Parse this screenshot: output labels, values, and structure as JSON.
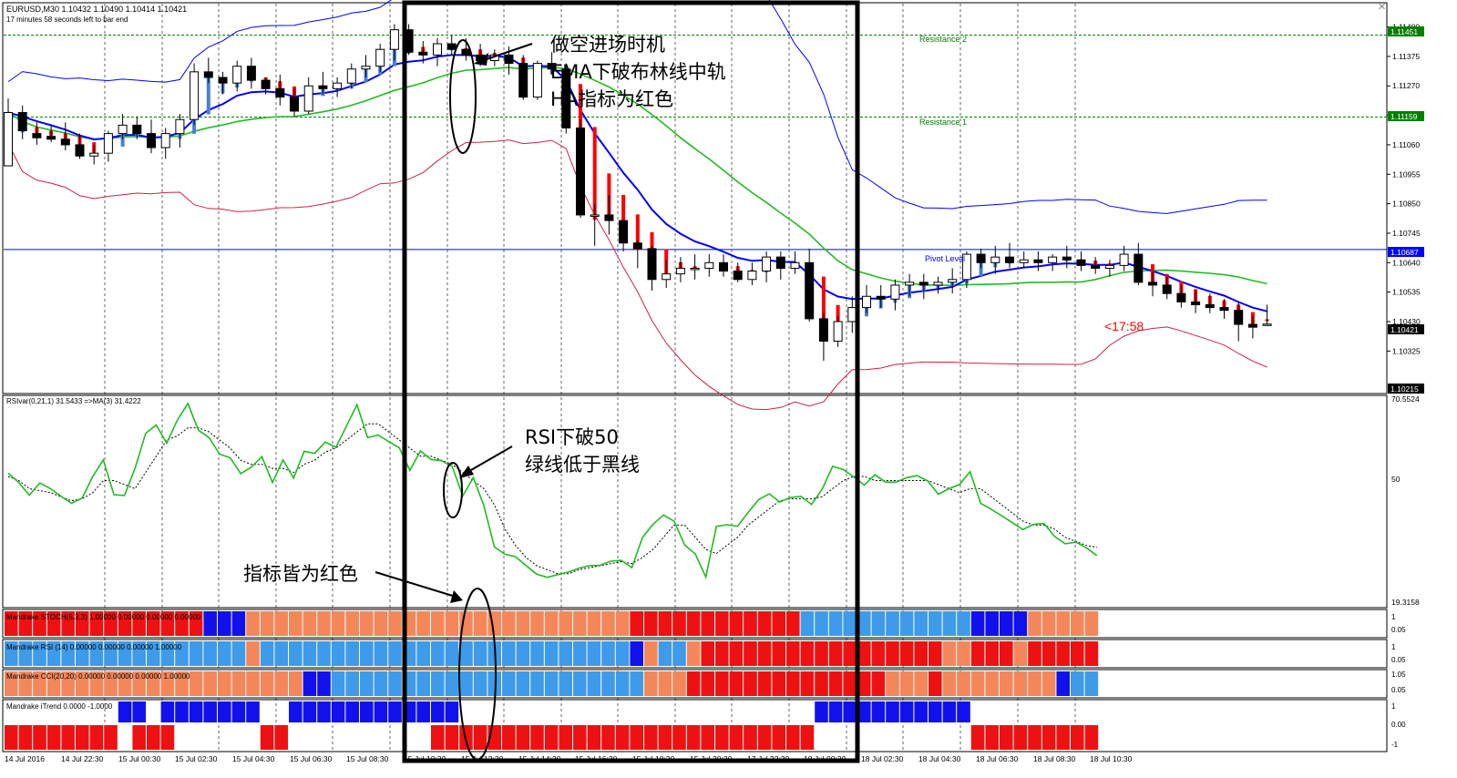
{
  "header": {
    "symbol_line": "EURUSD,M30  1.10432 1.10490 1.10414 1.10421",
    "timer_line": "17 minutes 58 seconds left to bar end"
  },
  "levels": {
    "resistance2": "Resistance 2",
    "resistance1": "Resistance 1",
    "pivot": "Pivot Level",
    "resistance2_price": "1.11451",
    "resistance1_price": "1.11159",
    "pivot_price": "1.10687",
    "current_price": "1.10421",
    "low_price": "1.10215"
  },
  "countdown": "<17:58",
  "annotations": {
    "entry_1": "做空进场时机",
    "entry_2": "EMA下破布林线中轨",
    "entry_3": "HA指标为红色",
    "rsi_1": "RSI下破50",
    "rsi_2": "绿线低于黑线",
    "mandrake": "指标皆为红色"
  },
  "panels": {
    "rsi_label": "RSIvar(0,21,1) 31.5433  =>MA(3) 31.4222",
    "rsi_top": "70.5524",
    "rsi_mid": "50",
    "rsi_bottom": "19.3158",
    "stoch_label": "Mandrake STOCH(5,3,3) 1.00000 0.00000 0.00000 0.00000",
    "rsi_bar_label": "Mandrake RSI (14) 0.00000 0.00000 0.00000 1.00000",
    "cci_label": "Mandrake CCI(20,20) 0.00000 0.00000 0.00000 1.00000",
    "itrend_label": "Mandrake iTrend 0.0000 -1.0000",
    "stoch_scale": [
      "1",
      "0.05"
    ],
    "rsi_bar_scale": [
      "1",
      "0.05"
    ],
    "cci_scale": [
      "1.05",
      "0.05"
    ],
    "itrend_scale": [
      "1",
      "0.00",
      "-1"
    ]
  },
  "time_axis": [
    "14 Jul 2016",
    "14 Jul 22:30",
    "15 Jul 00:30",
    "15 Jul 02:30",
    "15 Jul 04:30",
    "15 Jul 06:30",
    "15 Jul 08:30",
    "15 Jul 10:30",
    "15 Jul 12:30",
    "15 Jul 14:30",
    "15 Jul 16:30",
    "15 Jul 18:30",
    "15 Jul 20:30",
    "17 Jul 22:30",
    "18 Jul 00:30",
    "18 Jul 02:30",
    "18 Jul 04:30",
    "18 Jul 06:30",
    "18 Jul 08:30",
    "18 Jul 10:30"
  ],
  "colors": {
    "bull_candle": "#ffffff",
    "bear_candle": "#000000",
    "ema": "#0000ff",
    "bb_mid": "#22bb22",
    "bb_upper": "#0000ff",
    "bb_lower": "#cc2244",
    "ha_bear": "#ff0000",
    "ha_bull": "#4a7fd8",
    "resistance": "#008000",
    "strong_red": "#ee1111",
    "light_red": "#f4875a",
    "strong_blue": "#1111ee",
    "light_blue": "#3d9be9"
  },
  "chart_data": {
    "type": "candlestick",
    "price_axis": [
      "1.11480",
      "1.11375",
      "1.11270",
      "1.11165",
      "1.11060",
      "1.10955",
      "1.10850",
      "1.10745",
      "1.10640",
      "1.10535",
      "1.10430",
      "1.10325"
    ],
    "ylim": [
      1.1018,
      1.1155
    ],
    "candles": [
      [
        1.10985,
        1.11225,
        1.1113,
        1.11175
      ],
      [
        1.11175,
        1.112,
        1.1108,
        1.1111
      ],
      [
        1.111,
        1.1114,
        1.1106,
        1.11085
      ],
      [
        1.1109,
        1.1113,
        1.1107,
        1.1108
      ],
      [
        1.1108,
        1.1114,
        1.1104,
        1.1106
      ],
      [
        1.1106,
        1.111,
        1.1101,
        1.1102
      ],
      [
        1.1102,
        1.1106,
        1.1099,
        1.1103
      ],
      [
        1.1103,
        1.1111,
        1.11,
        1.111
      ],
      [
        1.111,
        1.1117,
        1.1108,
        1.1113
      ],
      [
        1.1113,
        1.1116,
        1.1108,
        1.111
      ],
      [
        1.111,
        1.1115,
        1.1103,
        1.1105
      ],
      [
        1.1105,
        1.1112,
        1.1101,
        1.111
      ],
      [
        1.111,
        1.1117,
        1.1105,
        1.1115
      ],
      [
        1.1115,
        1.1135,
        1.1113,
        1.1132
      ],
      [
        1.1132,
        1.1137,
        1.1128,
        1.113
      ],
      [
        1.113,
        1.1132,
        1.1124,
        1.1128
      ],
      [
        1.1128,
        1.1136,
        1.1125,
        1.1134
      ],
      [
        1.1134,
        1.1137,
        1.1126,
        1.1129
      ],
      [
        1.1129,
        1.113,
        1.1124,
        1.1126
      ],
      [
        1.1126,
        1.1131,
        1.112,
        1.1123
      ],
      [
        1.1123,
        1.1126,
        1.1116,
        1.1118
      ],
      [
        1.1118,
        1.113,
        1.1117,
        1.1127
      ],
      [
        1.1127,
        1.1132,
        1.1124,
        1.1126
      ],
      [
        1.1126,
        1.113,
        1.1123,
        1.1128
      ],
      [
        1.1128,
        1.1135,
        1.1126,
        1.1133
      ],
      [
        1.1133,
        1.1138,
        1.113,
        1.1134
      ],
      [
        1.1134,
        1.1142,
        1.1132,
        1.114
      ],
      [
        1.114,
        1.1149,
        1.1136,
        1.1147
      ],
      [
        1.1147,
        1.1149,
        1.1138,
        1.1139
      ],
      [
        1.1139,
        1.1143,
        1.1135,
        1.1138
      ],
      [
        1.1138,
        1.1144,
        1.1134,
        1.1142
      ],
      [
        1.1142,
        1.1145,
        1.1138,
        1.114
      ],
      [
        1.114,
        1.1144,
        1.1136,
        1.1138
      ],
      [
        1.1138,
        1.1142,
        1.1134,
        1.1136
      ],
      [
        1.1136,
        1.114,
        1.1134,
        1.1138
      ],
      [
        1.1138,
        1.1141,
        1.1131,
        1.1135
      ],
      [
        1.1135,
        1.1138,
        1.1122,
        1.1123
      ],
      [
        1.1123,
        1.1136,
        1.1122,
        1.1135
      ],
      [
        1.1135,
        1.1139,
        1.1131,
        1.1133
      ],
      [
        1.1133,
        1.1135,
        1.111,
        1.1112
      ],
      [
        1.1112,
        1.1115,
        1.108,
        1.1081
      ],
      [
        1.1081,
        1.1085,
        1.107,
        1.1081
      ],
      [
        1.1081,
        1.1088,
        1.1074,
        1.1079
      ],
      [
        1.1079,
        1.1079,
        1.1068,
        1.1071
      ],
      [
        1.1071,
        1.1072,
        1.1062,
        1.1069
      ],
      [
        1.1069,
        1.107,
        1.1054,
        1.1058
      ],
      [
        1.1058,
        1.1065,
        1.1055,
        1.106
      ],
      [
        1.106,
        1.1066,
        1.1057,
        1.1062
      ],
      [
        1.1062,
        1.1067,
        1.1058,
        1.1062
      ],
      [
        1.1062,
        1.1067,
        1.1059,
        1.1064
      ],
      [
        1.1064,
        1.1067,
        1.1059,
        1.1061
      ],
      [
        1.1061,
        1.1064,
        1.1057,
        1.1058
      ],
      [
        1.1058,
        1.1064,
        1.1056,
        1.1061
      ],
      [
        1.1061,
        1.1068,
        1.1057,
        1.1066
      ],
      [
        1.1066,
        1.1068,
        1.1058,
        1.1062
      ],
      [
        1.1062,
        1.1068,
        1.106,
        1.1064
      ],
      [
        1.1064,
        1.1069,
        1.1043,
        1.1044
      ],
      [
        1.1044,
        1.1046,
        1.1029,
        1.1036
      ],
      [
        1.1036,
        1.1045,
        1.1034,
        1.1043
      ],
      [
        1.1043,
        1.1052,
        1.1039,
        1.1048
      ],
      [
        1.1048,
        1.1056,
        1.1046,
        1.1052
      ],
      [
        1.1052,
        1.1056,
        1.1048,
        1.1051
      ],
      [
        1.1051,
        1.1058,
        1.1047,
        1.1056
      ],
      [
        1.1056,
        1.106,
        1.1052,
        1.1057
      ],
      [
        1.1057,
        1.106,
        1.1051,
        1.1056
      ],
      [
        1.1056,
        1.1059,
        1.1053,
        1.1057
      ],
      [
        1.1057,
        1.1062,
        1.1053,
        1.1058
      ],
      [
        1.1058,
        1.1068,
        1.1055,
        1.1067
      ],
      [
        1.1067,
        1.1069,
        1.1062,
        1.1064
      ],
      [
        1.1064,
        1.107,
        1.106,
        1.1066
      ],
      [
        1.1066,
        1.1071,
        1.1062,
        1.1064
      ],
      [
        1.1064,
        1.1068,
        1.1062,
        1.1065
      ],
      [
        1.1065,
        1.1068,
        1.1061,
        1.1064
      ],
      [
        1.1064,
        1.1067,
        1.1061,
        1.1066
      ],
      [
        1.1066,
        1.107,
        1.1062,
        1.1065
      ],
      [
        1.1065,
        1.1068,
        1.1061,
        1.1063
      ],
      [
        1.1063,
        1.1066,
        1.106,
        1.1062
      ],
      [
        1.1062,
        1.1065,
        1.1059,
        1.1063
      ],
      [
        1.1063,
        1.107,
        1.1061,
        1.1067
      ],
      [
        1.1067,
        1.1071,
        1.1056,
        1.1057
      ],
      [
        1.1057,
        1.1061,
        1.1052,
        1.1056
      ],
      [
        1.1056,
        1.1059,
        1.1051,
        1.1053
      ],
      [
        1.1053,
        1.1056,
        1.1048,
        1.105
      ],
      [
        1.105,
        1.1054,
        1.1046,
        1.1049
      ],
      [
        1.1049,
        1.1053,
        1.1046,
        1.1048
      ],
      [
        1.1048,
        1.1051,
        1.1044,
        1.1047
      ],
      [
        1.1047,
        1.105,
        1.1036,
        1.1042
      ],
      [
        1.1042,
        1.1045,
        1.1037,
        1.1041
      ],
      [
        1.1042,
        1.1049,
        1.10414,
        1.10421
      ]
    ],
    "rsi": [
      51.8,
      49.5,
      46.4,
      49.4,
      48.0,
      46.1,
      44.4,
      45.7,
      51.0,
      55.1,
      46.5,
      46.3,
      53.0,
      61.6,
      63.7,
      59.2,
      64.9,
      69.0,
      62.4,
      60.6,
      56.5,
      55.6,
      51.7,
      53.3,
      55.9,
      49.5,
      55.1,
      50.6,
      57.2,
      56.7,
      59.5,
      58.2,
      63.4,
      68.7,
      60.6,
      61.2,
      59.6,
      58.1,
      52.5,
      57.3,
      55.2,
      54.9,
      53.5,
      46.2,
      50.7,
      43.8,
      33.6,
      31.8,
      31.2,
      29.0,
      26.9,
      26.1,
      26.8,
      27.4,
      28.4,
      29.0,
      29.1,
      30.1,
      30.3,
      28.5,
      35.9,
      39.2,
      41.5,
      40.0,
      34.1,
      31.9,
      26.2,
      38.7,
      39.1,
      38.7,
      42.1,
      45.3,
      46.7,
      44.7,
      45.8,
      46.1,
      44.1,
      47.8,
      53.5,
      52.7,
      50.9,
      48.9,
      51.4,
      49.6,
      49.6,
      50.7,
      51.2,
      49.9,
      46.6,
      48.0,
      49.0,
      52.2,
      44.4,
      42.9,
      41.3,
      39.6,
      37.9,
      39.2,
      39.4,
      36.2,
      34.4,
      34.8,
      33.4,
      31.5
    ],
    "rsi_ma": [
      51.0,
      50.0,
      48.0,
      47.5,
      47.0,
      46.0,
      45.0,
      45.5,
      47.0,
      50.0,
      50.0,
      49.0,
      48.0,
      52.0,
      56.0,
      60.0,
      61.0,
      63.0,
      63.0,
      62.0,
      60.0,
      58.0,
      55.0,
      54.0,
      54.0,
      53.0,
      53.0,
      52.0,
      54.0,
      55.0,
      57.0,
      58.0,
      60.0,
      62.0,
      64.0,
      64.0,
      62.0,
      60.0,
      58.0,
      56.0,
      56.0,
      55.0,
      54.0,
      52.0,
      50.0,
      48.0,
      44.0,
      38.0,
      34.0,
      31.0,
      29.0,
      28.0,
      27.0,
      27.0,
      28.0,
      28.5,
      29.0,
      29.5,
      30.0,
      29.5,
      31.0,
      33.0,
      36.0,
      39.0,
      39.0,
      36.0,
      33.0,
      32.0,
      34.0,
      36.0,
      39.0,
      41.0,
      43.0,
      45.0,
      45.5,
      45.5,
      45.5,
      46.0,
      48.0,
      50.0,
      51.0,
      51.0,
      50.0,
      50.0,
      50.0,
      50.0,
      50.0,
      50.0,
      49.0,
      48.0,
      47.0,
      48.0,
      48.0,
      46.0,
      44.0,
      42.0,
      40.0,
      39.0,
      39.0,
      38.0,
      36.0,
      35.0,
      34.0,
      33.5
    ]
  }
}
